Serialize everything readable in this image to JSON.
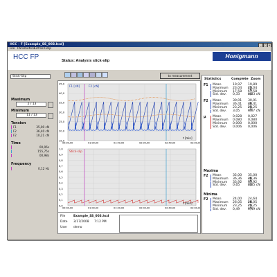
{
  "window": {
    "title": "HCC - F [Example_SS_003.hcd]",
    "menu": [
      "File",
      "Parameters",
      "Extras",
      "Help"
    ]
  },
  "header": {
    "app_title": "HCC FP",
    "status_label": "Status:",
    "status_value": "Analysis stick-slip",
    "logo_text": "Honigmann",
    "measure_button": "to measurement"
  },
  "sidebar": {
    "mode_field": "Stick-Slip",
    "maximum_label": "Maximum",
    "maximum_value": "2 / 13",
    "minimum_label": "Minimum",
    "minimum_value": "11 / 13",
    "tension_label": "Tension",
    "tension_rows": [
      {
        "icon": "F1",
        "value": "35,00 cN",
        "color": "#3050c0"
      },
      {
        "icon": "F2",
        "value": "36,40 cN",
        "color": "#3050c0"
      },
      {
        "icon": "F2",
        "value": "10,21 cN",
        "color": "#3050c0"
      }
    ],
    "time_label": "Time",
    "time_rows": [
      {
        "icon": "|",
        "value": "00,06s",
        "color": "#c040c0"
      },
      {
        "icon": "|",
        "value": "155,75s",
        "color": "#40a0d0"
      },
      {
        "icon": "|",
        "value": "00,98s",
        "color": "#c040c0"
      }
    ],
    "frequency_label": "Frequency",
    "frequency_value": "0,12 Hz"
  },
  "chart": {
    "top": {
      "labels": [
        "F1 [cN]",
        "F2 [cN]"
      ],
      "y_ticks": [
        "45,0",
        "40,0",
        "35,0",
        "30,0",
        "25,0",
        "20,0",
        "15,0"
      ],
      "x_ticks": [
        "00:00,00",
        "01:00,00",
        "01:40,00",
        "02:00,00",
        "02:40,00",
        "03:00,00"
      ],
      "x_unit": "t [min]"
    },
    "bottom": {
      "label": "Stick-slip",
      "y_ticks": [
        "1,0",
        "0,9",
        "0,8",
        "0,7",
        "0,6",
        "0,5",
        "0,4",
        "0,3",
        "0,2",
        "0,1",
        "0,0"
      ],
      "x_ticks": [
        "00:00,00",
        "01:00,00",
        "01:40,00",
        "02:00,00",
        "02:40,00",
        "03:00,00"
      ],
      "x_unit": "t [min]"
    }
  },
  "info": {
    "file_label": "File",
    "file_value": "Example_SS_003.hcd",
    "date_label": "Date",
    "date_value": "3/17/2008",
    "time_value": "7:12 PM",
    "user_label": "User",
    "user_value": "demo"
  },
  "statistics": {
    "title": "Statistics",
    "col_complete": "Complete",
    "col_zoom": "Zoom",
    "groups": [
      {
        "name": "F1",
        "color": "#3050c0",
        "rows": [
          {
            "label": "Mean",
            "complete": "19,97",
            "zoom": "19,89 cN"
          },
          {
            "label": "Maximum",
            "complete": "23,04",
            "zoom": "23,04 cN"
          },
          {
            "label": "Minimum",
            "complete": "17,58",
            "zoom": "17,58 cN"
          },
          {
            "label": "Std. dev.",
            "complete": "0,33",
            "zoom": "0,33 cN"
          }
        ]
      },
      {
        "name": "F2",
        "color": "#3050c0",
        "rows": [
          {
            "label": "Mean",
            "complete": "30,01",
            "zoom": "30,01 cN"
          },
          {
            "label": "Maximum",
            "complete": "36,41",
            "zoom": "36,41 cN"
          },
          {
            "label": "Minimum",
            "complete": "23,25",
            "zoom": "23,25 cN"
          },
          {
            "label": "Std. dev.",
            "complete": "3,05",
            "zoom": "3,07 cN"
          }
        ]
      },
      {
        "name": "μ",
        "color": "#d03030",
        "rows": [
          {
            "label": "Mean",
            "complete": "0,028",
            "zoom": "0,027"
          },
          {
            "label": "Maximum",
            "complete": "0,080",
            "zoom": "0,080"
          },
          {
            "label": "Minimum",
            "complete": "0,000",
            "zoom": "0,000"
          },
          {
            "label": "Std. dev.",
            "complete": "0,006",
            "zoom": "0,006"
          }
        ]
      }
    ],
    "maxima_title": "Maxima",
    "maxima": {
      "name": "F2",
      "color": "#3050c0",
      "rows": [
        {
          "label": "Mean",
          "complete": "35,00",
          "zoom": "35,00 cN"
        },
        {
          "label": "Maximum",
          "complete": "36,36",
          "zoom": "36,36 cN"
        },
        {
          "label": "Minimum",
          "complete": "33,92",
          "zoom": "33,92 cN"
        },
        {
          "label": "Std. dev.",
          "complete": "0,65",
          "zoom": "0,65 cN"
        }
      ]
    },
    "minima_title": "Minima",
    "minima": {
      "name": "F2",
      "color": "#3050c0",
      "rows": [
        {
          "label": "Mean",
          "complete": "24,00",
          "zoom": "24,64 cN"
        },
        {
          "label": "Maximum",
          "complete": "26,05",
          "zoom": "26,05 cN"
        },
        {
          "label": "Minimum",
          "complete": "23,25",
          "zoom": "23,25 cN"
        },
        {
          "label": "Std. dev.",
          "complete": "0,49",
          "zoom": "0,49 cN"
        }
      ]
    }
  }
}
